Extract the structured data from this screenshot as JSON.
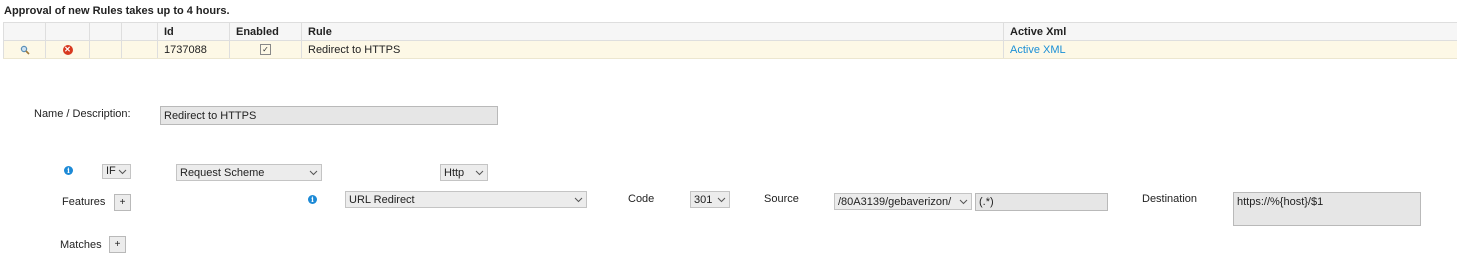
{
  "notice": "Approval of new Rules takes up to 4 hours.",
  "table": {
    "headers": [
      "",
      "",
      "",
      "",
      "Id",
      "Enabled",
      "Rule",
      "Active Xml"
    ],
    "rows": [
      {
        "id": "1737088",
        "enabled": true,
        "rule": "Redirect to HTTPS",
        "active_xml": "Active XML"
      }
    ]
  },
  "form": {
    "name_label": "Name / Description:",
    "name_value": "Redirect to HTTPS",
    "if_select": "IF",
    "condition_select": "Request Scheme",
    "scheme_select": "Http",
    "features_label": "Features",
    "features_add": "+",
    "feature_select": "URL Redirect",
    "code_label": "Code",
    "code_select": "301",
    "source_label": "Source",
    "source_select": "/80A3139/gebaverizon/",
    "source_pattern": "(.*)",
    "destination_label": "Destination",
    "destination_value": "https://%{host}/$1",
    "matches_label": "Matches",
    "matches_add": "+"
  },
  "colors": {
    "link": "#1a8fd6",
    "info": "#1d8ad6",
    "delete": "#d8391f",
    "row_highlight": "#fdf8e6"
  }
}
